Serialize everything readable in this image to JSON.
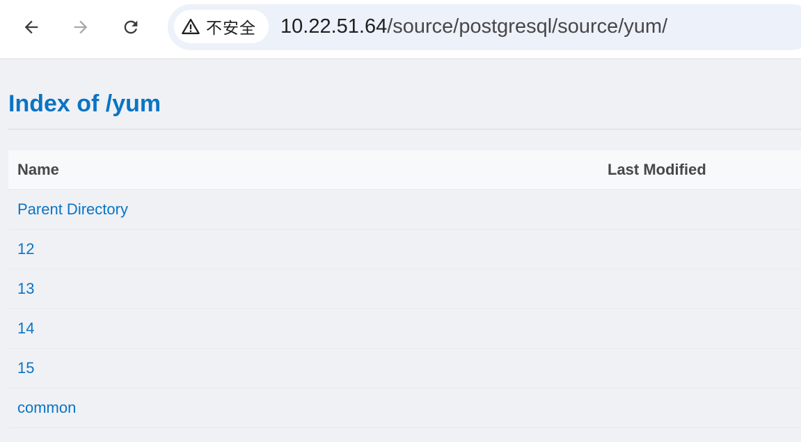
{
  "browser": {
    "security_label": "不安全",
    "url_host": "10.22.51.64",
    "url_path": "/source/postgresql/source/yum/"
  },
  "icons": {
    "back": "back-arrow-icon",
    "forward": "forward-arrow-icon",
    "reload": "reload-icon",
    "security": "warning-triangle-icon"
  },
  "colors": {
    "link": "#0a74c4",
    "page_bg": "#f0f1f5",
    "header_text": "#474747"
  },
  "page": {
    "title": "Index of /yum"
  },
  "listing": {
    "headers": {
      "name": "Name",
      "last_modified": "Last Modified"
    },
    "rows": [
      {
        "name": "Parent Directory",
        "last_modified": ""
      },
      {
        "name": "12",
        "last_modified": ""
      },
      {
        "name": "13",
        "last_modified": ""
      },
      {
        "name": "14",
        "last_modified": ""
      },
      {
        "name": "15",
        "last_modified": ""
      },
      {
        "name": "common",
        "last_modified": ""
      }
    ]
  }
}
